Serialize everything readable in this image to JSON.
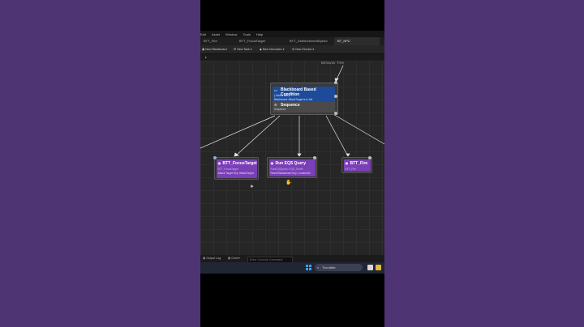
{
  "menu": [
    "Edit",
    "Asset",
    "Window",
    "Tools",
    "Help"
  ],
  "tabs": [
    {
      "label": "BTT_Fire"
    },
    {
      "label": "BTT_FocusTarget"
    },
    {
      "label": "BTT_GetMovementSpeed"
    },
    {
      "label": "BT_NPC"
    }
  ],
  "toolbar": {
    "new_blackboard": "New Blackboard",
    "new_task": "New Task",
    "new_decorator": "New Decorator",
    "new_service": "New Service"
  },
  "graph": {
    "label": "Behavior Tree",
    "root": {
      "decorator_title": "Blackboard Based Condition",
      "decorator_line1": "( Aborts self )",
      "decorator_line2": "Blackboard: AttackTarget is is Set",
      "composite_title": "Sequence",
      "composite_sub": "Sequence"
    },
    "tasks": [
      {
        "title": "BTT_FocusTarget",
        "class": "BTT_FocusTarget",
        "detail": "Attack Target Key: AttackTarget"
      },
      {
        "title": "Run EQS Query",
        "class": "RunEQSQuery: EQS_Strafe",
        "detail": "Result Blackboard Key: LocationDI"
      },
      {
        "title": "BTT_Fire",
        "class": "BTT_Fire",
        "detail": ""
      }
    ]
  },
  "bottom": {
    "output_log": "Output Log",
    "cmd": "Cmd",
    "cmd_placeholder": "Enter Console Command"
  },
  "taskbar": {
    "search_text": "Tìm kiếm"
  }
}
